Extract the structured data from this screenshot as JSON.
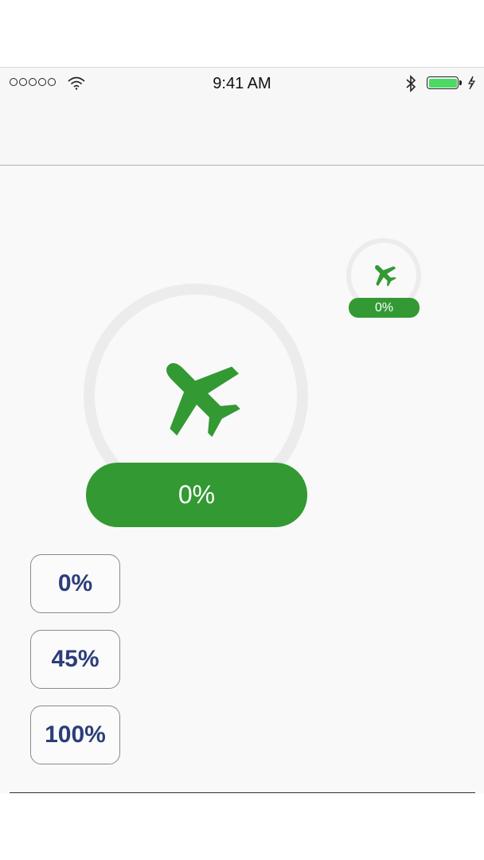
{
  "status_bar": {
    "time": "9:41 AM",
    "signal_dots": 5,
    "icons": [
      "signal-dots-icon",
      "wifi-icon",
      "bluetooth-icon",
      "battery-icon",
      "charging-bolt-icon"
    ]
  },
  "progress_large": {
    "label": "0%",
    "progress": 0,
    "icon": "airplane-icon",
    "color": "#339933",
    "track_color": "#ececec"
  },
  "progress_small": {
    "label": "0%",
    "progress": 0,
    "icon": "airplane-icon",
    "color": "#339933"
  },
  "buttons": [
    {
      "label": "0%"
    },
    {
      "label": "45%"
    },
    {
      "label": "100%"
    }
  ],
  "colors": {
    "accent": "#339933",
    "button_text": "#2c3e7a",
    "battery": "#4cd964"
  }
}
